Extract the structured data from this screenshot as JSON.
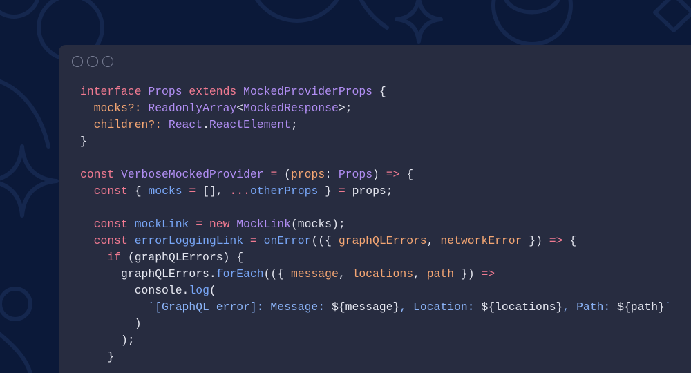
{
  "theme": {
    "page_background": "#0b1939",
    "pattern_stroke": "#15274e",
    "window_background": "#272c40",
    "window_control_stroke": "#7b8197",
    "syntax_colors": {
      "keyword": "#f07a91",
      "type": "#b18ef3",
      "property": "#f4a673",
      "variable": "#78a6f6",
      "punctuation": "#e3e5ee",
      "string": "#8ab2f5"
    }
  },
  "code": {
    "lines": [
      [
        {
          "keyword": "interface "
        },
        {
          "type": "Props "
        },
        {
          "keyword": "extends "
        },
        {
          "type": "MockedProviderProps "
        },
        {
          "punctuation": "{"
        }
      ],
      [
        {
          "property": "  mocks?: "
        },
        {
          "type": "ReadonlyArray"
        },
        {
          "punctuation": "<"
        },
        {
          "type": "MockedResponse"
        },
        {
          "punctuation": ">;"
        }
      ],
      [
        {
          "property": "  children?: "
        },
        {
          "type": "React"
        },
        {
          "punctuation": "."
        },
        {
          "type": "ReactElement"
        },
        {
          "punctuation": ";"
        }
      ],
      [
        {
          "punctuation": "}"
        }
      ],
      [],
      [
        {
          "keyword": "const "
        },
        {
          "type": "VerboseMockedProvider "
        },
        {
          "keyword": "= "
        },
        {
          "punctuation": "("
        },
        {
          "property": "props"
        },
        {
          "punctuation": ": "
        },
        {
          "type": "Props"
        },
        {
          "punctuation": ") "
        },
        {
          "keyword": "=> "
        },
        {
          "punctuation": "{"
        }
      ],
      [
        {
          "keyword": "  const "
        },
        {
          "punctuation": "{ "
        },
        {
          "variable": "mocks "
        },
        {
          "keyword": "= "
        },
        {
          "punctuation": "[], "
        },
        {
          "keyword": "..."
        },
        {
          "variable": "otherProps "
        },
        {
          "punctuation": "} "
        },
        {
          "keyword": "= "
        },
        {
          "punctuation": "props;"
        }
      ],
      [],
      [
        {
          "keyword": "  const "
        },
        {
          "variable": "mockLink "
        },
        {
          "keyword": "= new "
        },
        {
          "type": "MockLink"
        },
        {
          "punctuation": "(mocks);"
        }
      ],
      [
        {
          "keyword": "  const "
        },
        {
          "variable": "errorLoggingLink "
        },
        {
          "keyword": "= "
        },
        {
          "variable": "onError"
        },
        {
          "punctuation": "(({ "
        },
        {
          "property": "graphQLErrors"
        },
        {
          "punctuation": ", "
        },
        {
          "property": "networkError"
        },
        {
          "punctuation": " }) "
        },
        {
          "keyword": "=> "
        },
        {
          "punctuation": "{"
        }
      ],
      [
        {
          "keyword": "    if "
        },
        {
          "punctuation": "(graphQLErrors) {"
        }
      ],
      [
        {
          "punctuation": "      graphQLErrors."
        },
        {
          "variable": "forEach"
        },
        {
          "punctuation": "(({ "
        },
        {
          "property": "message"
        },
        {
          "punctuation": ", "
        },
        {
          "property": "locations"
        },
        {
          "punctuation": ", "
        },
        {
          "property": "path"
        },
        {
          "punctuation": " }) "
        },
        {
          "keyword": "=>"
        }
      ],
      [
        {
          "punctuation": "        console."
        },
        {
          "variable": "log"
        },
        {
          "punctuation": "("
        }
      ],
      [
        {
          "string": "          `[GraphQL error]: Message: "
        },
        {
          "punctuation": "${message}"
        },
        {
          "string": ", Location: "
        },
        {
          "punctuation": "${locations}"
        },
        {
          "string": ", Path: "
        },
        {
          "punctuation": "${path}"
        },
        {
          "string": "`"
        }
      ],
      [
        {
          "punctuation": "        )"
        }
      ],
      [
        {
          "punctuation": "      );"
        }
      ],
      [
        {
          "punctuation": "    }"
        }
      ]
    ]
  }
}
